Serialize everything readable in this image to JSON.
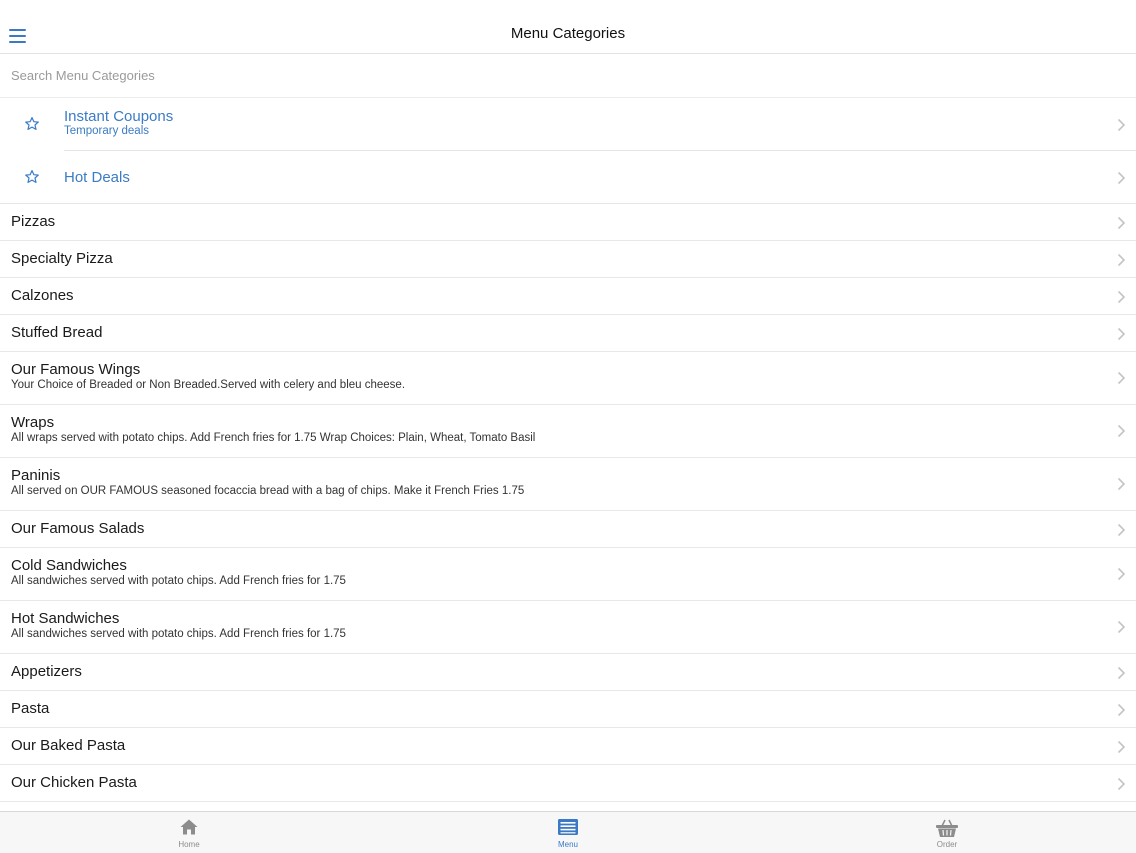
{
  "header": {
    "title": "Menu Categories",
    "menu_icon": "hamburger-icon"
  },
  "search": {
    "placeholder": "Search Menu Categories",
    "value": ""
  },
  "specials": [
    {
      "title": "Instant Coupons",
      "subtitle": "Temporary deals",
      "icon": "star-icon"
    },
    {
      "title": "Hot Deals",
      "subtitle": "",
      "icon": "star-icon"
    }
  ],
  "categories": [
    {
      "title": "Pizzas",
      "description": ""
    },
    {
      "title": "Specialty Pizza",
      "description": ""
    },
    {
      "title": "Calzones",
      "description": ""
    },
    {
      "title": "Stuffed Bread",
      "description": ""
    },
    {
      "title": "Our Famous Wings",
      "description": "Your Choice of Breaded or Non Breaded.Served with celery and bleu cheese."
    },
    {
      "title": "Wraps",
      "description": "All wraps served with potato chips. Add French fries for 1.75 Wrap Choices: Plain, Wheat, Tomato Basil"
    },
    {
      "title": "Paninis",
      "description": "All served on OUR FAMOUS seasoned focaccia bread with a bag of chips. Make it French Fries 1.75"
    },
    {
      "title": "Our Famous Salads",
      "description": ""
    },
    {
      "title": "Cold Sandwiches",
      "description": "All sandwiches served with potato chips. Add French fries for 1.75"
    },
    {
      "title": "Hot Sandwiches",
      "description": "All sandwiches served with potato chips. Add French fries for 1.75"
    },
    {
      "title": "Appetizers",
      "description": ""
    },
    {
      "title": "Pasta",
      "description": ""
    },
    {
      "title": "Our Baked Pasta",
      "description": ""
    },
    {
      "title": "Our Chicken Pasta",
      "description": ""
    }
  ],
  "tabs": [
    {
      "label": "Home",
      "icon": "home-icon",
      "active": false
    },
    {
      "label": "Menu",
      "icon": "menu-list-icon",
      "active": true
    },
    {
      "label": "Order",
      "icon": "basket-icon",
      "active": false
    }
  ],
  "colors": {
    "accent": "#3b79c5",
    "link": "#3b7cc4",
    "separator": "#e8e8e8",
    "tabbar": "#f7f7f7"
  }
}
